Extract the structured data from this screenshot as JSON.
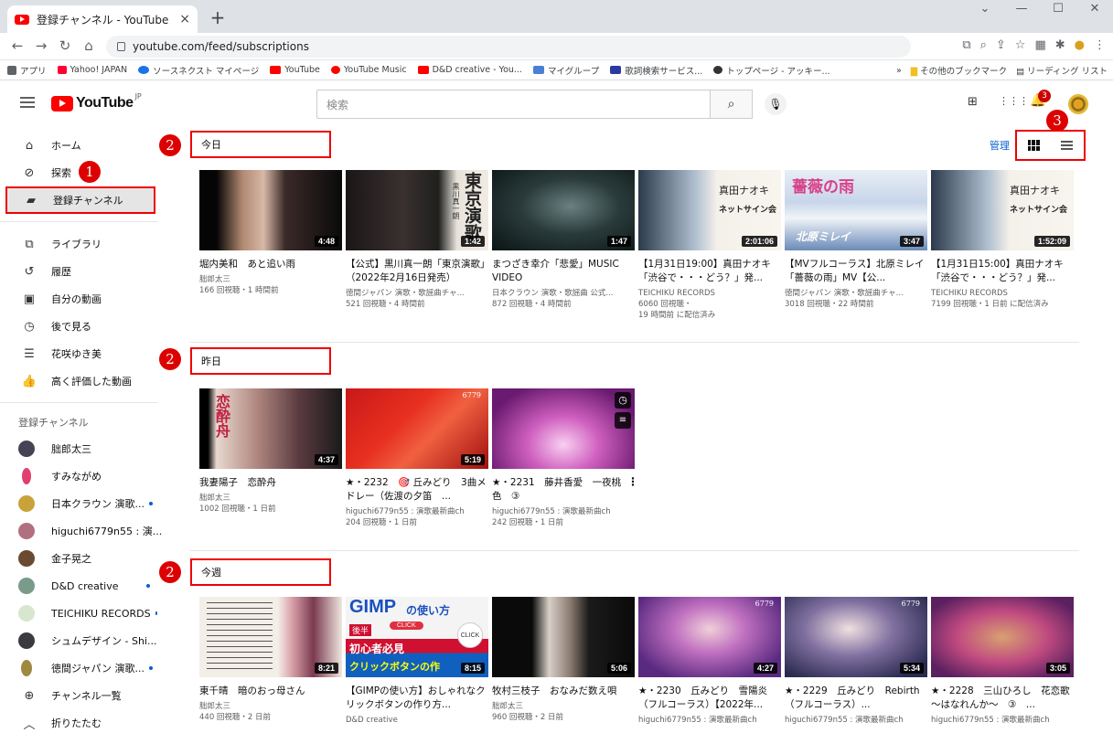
{
  "browser": {
    "tab_title": "登録チャンネル - YouTube",
    "tab_close": "×",
    "new_tab": "+",
    "url": "youtube.com/feed/subscriptions"
  },
  "bookmarks": {
    "items": [
      "アプリ",
      "Yahoo! JAPAN",
      "ソースネクスト マイページ",
      "YouTube",
      "YouTube Music",
      "D&D creative - You...",
      "マイグループ",
      "歌詞検索サービス...",
      "トップページ - アッキー..."
    ],
    "other": "その他のブックマーク",
    "reading": "リーディング リスト",
    "more": "»"
  },
  "yt": {
    "logo": "YouTube",
    "region": "JP",
    "search_placeholder": "検索",
    "notif_count": "3"
  },
  "sidebar": {
    "nav": [
      "ホーム",
      "探索",
      "登録チャンネル"
    ],
    "lib": [
      "ライブラリ",
      "履歴",
      "自分の動画",
      "後で見る",
      "花咲ゆき美",
      "高く評価した動画"
    ],
    "subs_heading": "登録チャンネル",
    "channels": [
      "朏郎太三",
      "すみながめ",
      "日本クラウン 演歌...",
      "higuchi6779n55 : 演...",
      "金子晃之",
      "D&D creative",
      "TEICHIKU RECORDS",
      "シュムデザイン - Shi...",
      "徳間ジャパン 演歌...",
      "チャンネル一覧",
      "折りたたむ"
    ]
  },
  "main": {
    "manage": "管理"
  },
  "annotations": [
    "1",
    "2",
    "2",
    "2",
    "3"
  ],
  "sections": [
    {
      "title": "今日",
      "videos": [
        {
          "title": "堀内美和　あと追い雨",
          "channel": "朏郎太三",
          "meta": "166 回視聴・1 時間前",
          "meta2": "",
          "duration": "4:48"
        },
        {
          "title": "【公式】黒川真一朗「東京演歌」（2022年2月16日発売）",
          "channel": "徳間ジャパン 演歌・歌謡曲チャ...",
          "meta": "521 回視聴・4 時間前",
          "meta2": "",
          "duration": "1:42"
        },
        {
          "title": "まつざき幸介「悲愛」MUSIC VIDEO",
          "channel": "日本クラウン 演歌・歌謡曲 公式...",
          "meta": "872 回視聴・4 時間前",
          "meta2": "",
          "duration": "1:47"
        },
        {
          "title": "【1月31日19:00】真田ナオキ「渋谷で・・・どう？」発...",
          "channel": "TEICHIKU RECORDS",
          "meta": "6060 回視聴・",
          "meta2": "19 時間前 に配信済み",
          "duration": "2:01:06"
        },
        {
          "title": "【MVフルコーラス】北原ミレイ「薔薇の雨」MV【公...",
          "channel": "徳間ジャパン 演歌・歌謡曲チャ...",
          "meta": "3018 回視聴・22 時間前",
          "meta2": "",
          "duration": "3:47"
        },
        {
          "title": "【1月31日15:00】真田ナオキ「渋谷で・・・どう？」発...",
          "channel": "TEICHIKU RECORDS",
          "meta": "7199 回視聴・1 日前 に配信済み",
          "meta2": "",
          "duration": "1:52:09"
        }
      ]
    },
    {
      "title": "昨日",
      "videos": [
        {
          "title": "我妻陽子　恋酔舟",
          "channel": "朏郎太三",
          "meta": "1002 回視聴・1 日前",
          "meta2": "",
          "duration": "4:37"
        },
        {
          "title": "★・2232　🎯 丘みどり　3曲メドレー（佐渡の夕笛　...",
          "channel": "higuchi6779n55 : 演歌最新曲ch",
          "meta": "204 回視聴・1 日前",
          "meta2": "",
          "duration": "5:19"
        },
        {
          "title": "★・2231　藤井香愛　一夜桃色　③",
          "channel": "higuchi6779n55 : 演歌最新曲ch",
          "meta": "242 回視聴・1 日前",
          "meta2": "",
          "duration": ""
        }
      ]
    },
    {
      "title": "今週",
      "videos": [
        {
          "title": "東千晴　暗のおっ母さん",
          "channel": "朏郎太三",
          "meta": "440 回視聴・2 日前",
          "meta2": "",
          "duration": "8:21"
        },
        {
          "title": "【GIMPの使い方】おしゃれなクリックボタンの作り方...",
          "channel": "D&D creative",
          "meta": "",
          "meta2": "",
          "duration": "8:15"
        },
        {
          "title": "牧村三枝子　おなみだ数え唄",
          "channel": "朏郎太三",
          "meta": "960 回視聴・2 日前",
          "meta2": "",
          "duration": "5:06"
        },
        {
          "title": "★・2230　丘みどり　雪陽炎（フルコーラス）【2022年...",
          "channel": "higuchi6779n55 : 演歌最新曲ch",
          "meta": "",
          "meta2": "",
          "duration": "4:27"
        },
        {
          "title": "★・2229　丘みどり　Rebirth（フルコーラス）...",
          "channel": "higuchi6779n55 : 演歌最新曲ch",
          "meta": "",
          "meta2": "",
          "duration": "5:34"
        },
        {
          "title": "★・2228　三山ひろし　花恋歌～はなれんか～　③　...",
          "channel": "higuchi6779n55 : 演歌最新曲ch",
          "meta": "",
          "meta2": "",
          "duration": "3:05"
        }
      ]
    }
  ],
  "thumb_text": {
    "tokyo": "東京演歌",
    "kurokawa": "黒川真一朗",
    "sanada": "真田ナオキ",
    "sign": "ネットサイン会",
    "bara": "薔薇の雨",
    "kitahara": "北原ミレイ",
    "koi": "恋酔舟",
    "gimp": "GIMP",
    "gimp2": "の使い方",
    "kouhan": "後半",
    "shoshinsha": "初心者必見",
    "clickbtn": "クリックボタンの作",
    "click": "CLICK",
    "c6779": "6779"
  },
  "colors": {
    "accent": "#065fd4",
    "annotation": "#dd0000",
    "yt_red": "#ff0000"
  }
}
